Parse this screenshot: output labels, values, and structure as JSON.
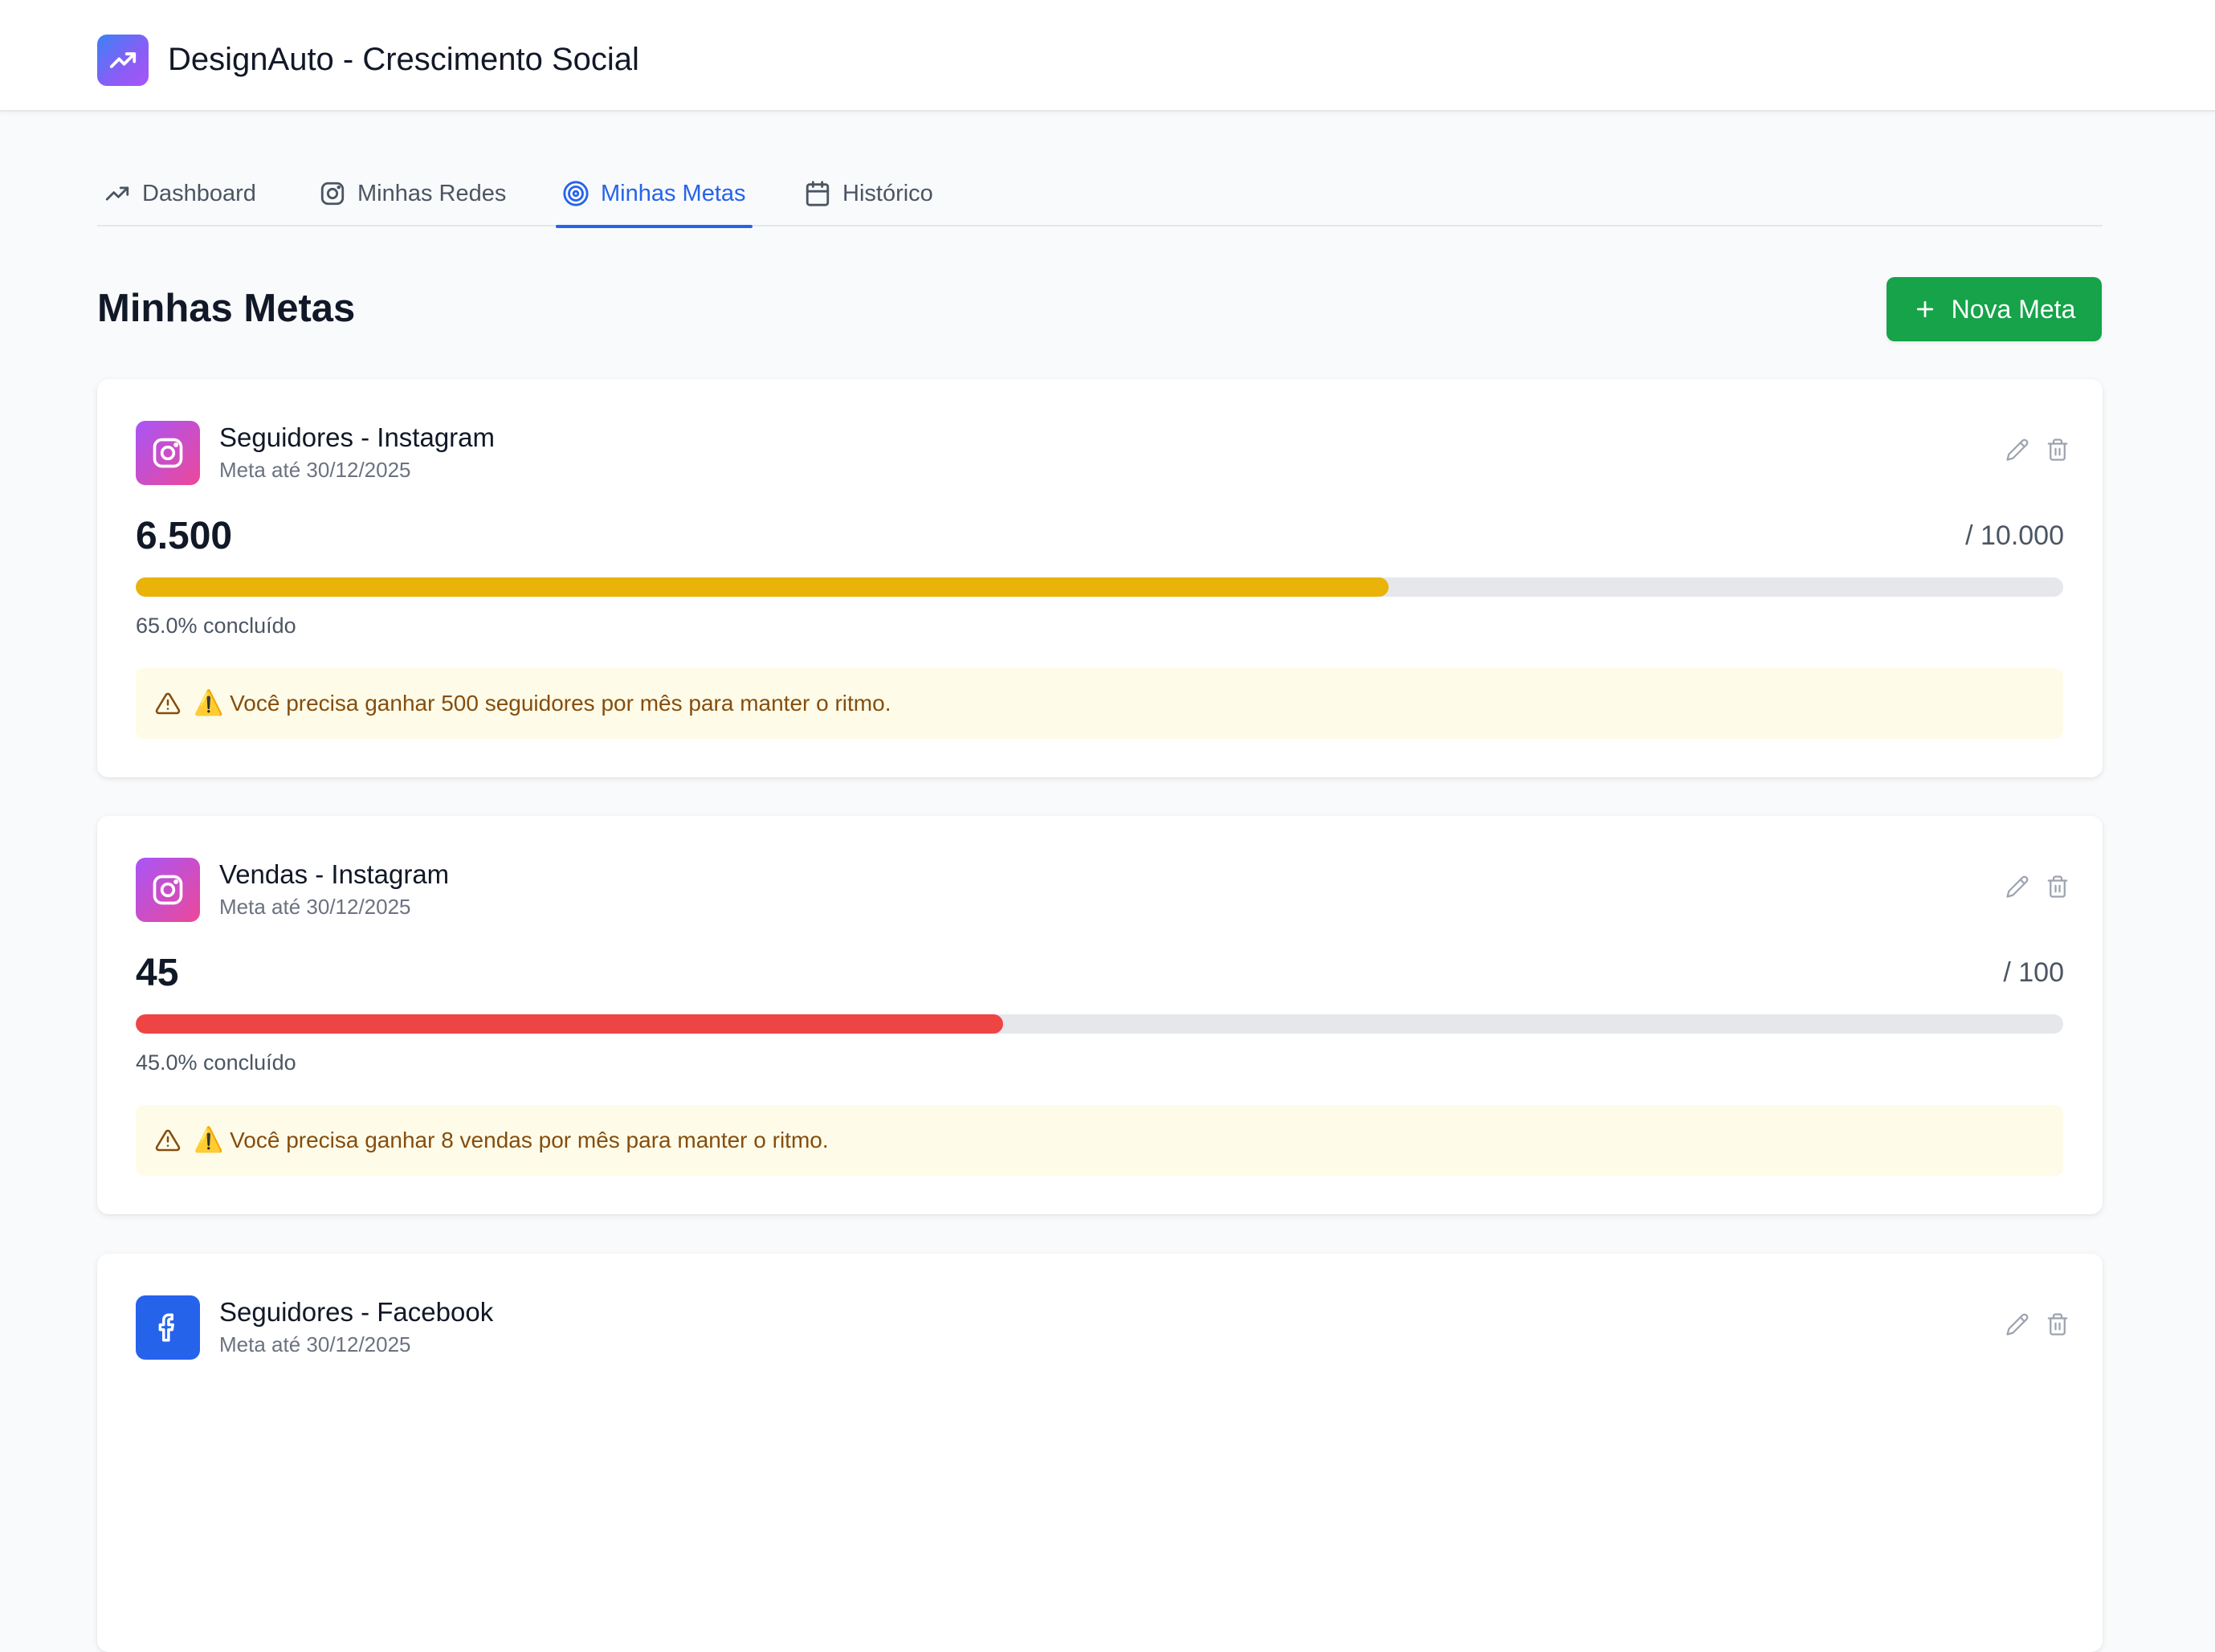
{
  "app": {
    "title": "DesignAuto - Crescimento Social",
    "logo_icon": "trending-up-icon"
  },
  "tabs": [
    {
      "label": "Dashboard",
      "icon": "trending-up-icon",
      "active": false
    },
    {
      "label": "Minhas Redes",
      "icon": "instagram-icon",
      "active": false
    },
    {
      "label": "Minhas Metas",
      "icon": "target-icon",
      "active": true
    },
    {
      "label": "Histórico",
      "icon": "calendar-icon",
      "active": false
    }
  ],
  "page": {
    "title": "Minhas Metas",
    "new_button_label": "Nova Meta"
  },
  "goals": [
    {
      "title": "Seguidores - Instagram",
      "deadline": "Meta até 30/12/2025",
      "platform": "instagram",
      "current": "6.500",
      "target": "/ 10.000",
      "progress": 0.65,
      "progress_label": "65.0% concluído",
      "bar_color": "#eab308",
      "alert_emoji": "⚠️",
      "alert": "Você precisa ganhar 500 seguidores por mês para manter o ritmo."
    },
    {
      "title": "Vendas - Instagram",
      "deadline": "Meta até 30/12/2025",
      "platform": "instagram",
      "current": "45",
      "target": "/ 100",
      "progress": 0.45,
      "progress_label": "45.0% concluído",
      "bar_color": "#ef4444",
      "alert_emoji": "⚠️",
      "alert": "Você precisa ganhar 8 vendas por mês para manter o ritmo."
    },
    {
      "title": "Seguidores - Facebook",
      "deadline": "Meta até 30/12/2025",
      "platform": "facebook"
    }
  ],
  "colors": {
    "accent": "#2563eb",
    "primary_button": "#16a34a",
    "alert_bg": "#fefce8",
    "alert_text": "#854d0e"
  }
}
